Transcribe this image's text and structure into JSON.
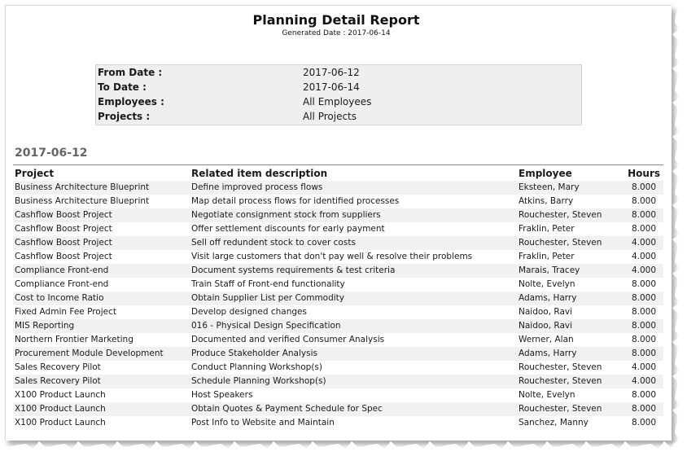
{
  "report": {
    "title": "Planning Detail Report",
    "generated_label": "Generated Date :",
    "generated_date": "2017-06-14"
  },
  "parameters": [
    {
      "label": "From Date :",
      "value": "2017-06-12"
    },
    {
      "label": "To Date :",
      "value": "2017-06-14"
    },
    {
      "label": "Employees :",
      "value": "All Employees"
    },
    {
      "label": "Projects :",
      "value": "All Projects"
    }
  ],
  "section": {
    "date": "2017-06-12",
    "columns": {
      "project": "Project",
      "description": "Related item description",
      "employee": "Employee",
      "hours": "Hours"
    },
    "rows": [
      {
        "project": "Business Architecture Blueprint",
        "description": "Define improved process flows",
        "employee": "Eksteen, Mary",
        "hours": "8.000"
      },
      {
        "project": "Business Architecture Blueprint",
        "description": "Map detail process flows for identified processes",
        "employee": "Atkins, Barry",
        "hours": "8.000"
      },
      {
        "project": "Cashflow Boost Project",
        "description": "Negotiate consignment stock from suppliers",
        "employee": "Rouchester, Steven",
        "hours": "8.000"
      },
      {
        "project": "Cashflow Boost Project",
        "description": "Offer settlement discounts for early payment",
        "employee": "Fraklin, Peter",
        "hours": "8.000"
      },
      {
        "project": "Cashflow Boost Project",
        "description": "Sell off redundent stock to cover costs",
        "employee": "Rouchester, Steven",
        "hours": "4.000"
      },
      {
        "project": "Cashflow Boost Project",
        "description": "Visit large customers that don't pay well & resolve their problems",
        "employee": "Fraklin, Peter",
        "hours": "4.000"
      },
      {
        "project": "Compliance Front-end",
        "description": "Document systems requirements & test criteria",
        "employee": "Marais, Tracey",
        "hours": "4.000"
      },
      {
        "project": "Compliance Front-end",
        "description": "Train Staff of Front-end functionality",
        "employee": "Nolte, Evelyn",
        "hours": "8.000"
      },
      {
        "project": "Cost to Income Ratio",
        "description": "Obtain Supplier List per Commodity",
        "employee": "Adams, Harry",
        "hours": "8.000"
      },
      {
        "project": "Fixed Admin Fee Project",
        "description": "Develop designed changes",
        "employee": "Naidoo, Ravi",
        "hours": "8.000"
      },
      {
        "project": "MIS Reporting",
        "description": "016 - Physical Design Specification",
        "employee": "Naidoo, Ravi",
        "hours": "8.000"
      },
      {
        "project": "Northern Frontier Marketing",
        "description": "Documented and verified Consumer Analysis",
        "employee": "Werner, Alan",
        "hours": "8.000"
      },
      {
        "project": "Procurement Module Development",
        "description": "Produce Stakeholder Analysis",
        "employee": "Adams, Harry",
        "hours": "8.000"
      },
      {
        "project": "Sales Recovery Pilot",
        "description": "Conduct Planning Workshop(s)",
        "employee": "Rouchester, Steven",
        "hours": "4.000"
      },
      {
        "project": "Sales Recovery Pilot",
        "description": "Schedule Planning Workshop(s)",
        "employee": "Rouchester, Steven",
        "hours": "4.000"
      },
      {
        "project": "X100 Product Launch",
        "description": "Host Speakers",
        "employee": "Nolte, Evelyn",
        "hours": "8.000"
      },
      {
        "project": "X100 Product Launch",
        "description": "Obtain Quotes & Payment Schedule for Spec",
        "employee": "Rouchester, Steven",
        "hours": "8.000"
      },
      {
        "project": "X100 Product Launch",
        "description": "Post Info to Website and Maintain",
        "employee": "Sanchez, Manny",
        "hours": "8.000"
      }
    ]
  }
}
